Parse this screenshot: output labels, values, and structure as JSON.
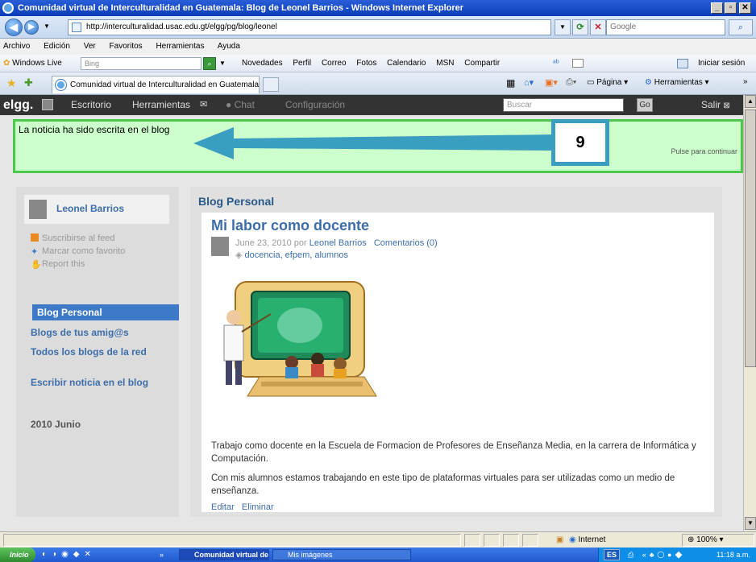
{
  "window": {
    "title": "Comunidad virtual de Interculturalidad en Guatemala: Blog de Leonel Barrios - Windows Internet Explorer",
    "minimize": "_",
    "maximize": "▫",
    "close": "✕"
  },
  "address_bar": {
    "url": "http://interculturalidad.usac.edu.gt/elgg/pg/blog/leonel",
    "search_placeholder": "Google"
  },
  "menu": [
    "Archivo",
    "Edición",
    "Ver",
    "Favoritos",
    "Herramientas",
    "Ayuda"
  ],
  "live_bar": {
    "brand": "Windows Live",
    "search_placeholder": "Bing",
    "links": [
      "Novedades",
      "Perfil",
      "Correo",
      "Fotos",
      "Calendario",
      "MSN",
      "Compartir"
    ],
    "signin": "Iniciar sesión"
  },
  "tab": {
    "title": "Comunidad virtual de Interculturalidad en Guatemala: ...",
    "tools": [
      "Página",
      "Herramientas"
    ]
  },
  "elgg_bar": {
    "logo": "elgg.",
    "items": [
      "Escritorio",
      "Herramientas",
      "Chat",
      "Configuración"
    ],
    "search_placeholder": "Buscar",
    "go": "Go",
    "logout": "Salir"
  },
  "message": {
    "text": "La noticia ha sido escrita en el blog",
    "continue": "Pulse para continuar"
  },
  "callout": {
    "number": "9"
  },
  "sidebar": {
    "owner": "Leonel Barrios",
    "links": [
      "Suscribirse al feed",
      "Marcar como favorito",
      "Report this"
    ],
    "nav": [
      "Blog Personal",
      "Blogs de tus amig@s",
      "Todos los blogs de la red",
      "Escribir noticia en el blog"
    ],
    "archive": "2010 Junio"
  },
  "main": {
    "heading": "Blog Personal",
    "post": {
      "title": "Mi labor como docente",
      "date": "June 23, 2010 por",
      "author": "Leonel Barrios",
      "comments": "Comentarios (0)",
      "tags": "docencia, efpem, alumnos",
      "paragraph1": "Trabajo como docente en la Escuela de Formacion de Profesores de Enseñanza Media, en la carrera de Informática y Computación.",
      "paragraph2": "Con mis alumnos estamos trabajando en este tipo de plataformas virtuales para ser utilizadas como un medio de enseñanza.",
      "edit": "Editar",
      "delete": "Eliminar"
    }
  },
  "status_bar": {
    "zone": "Internet",
    "zoom": "100%"
  },
  "taskbar": {
    "start": "Inicio",
    "tasks": [
      "Comunidad virtual de ...",
      "Mis imágenes"
    ],
    "lang": "ES",
    "time": "11:18 a.m."
  },
  "colors": {
    "message_bg": "#ccffcc",
    "message_border": "#4cc94c",
    "link": "#3d6eaa",
    "callout_border": "#3a9ec0",
    "arrow": "#3a9ec0"
  }
}
